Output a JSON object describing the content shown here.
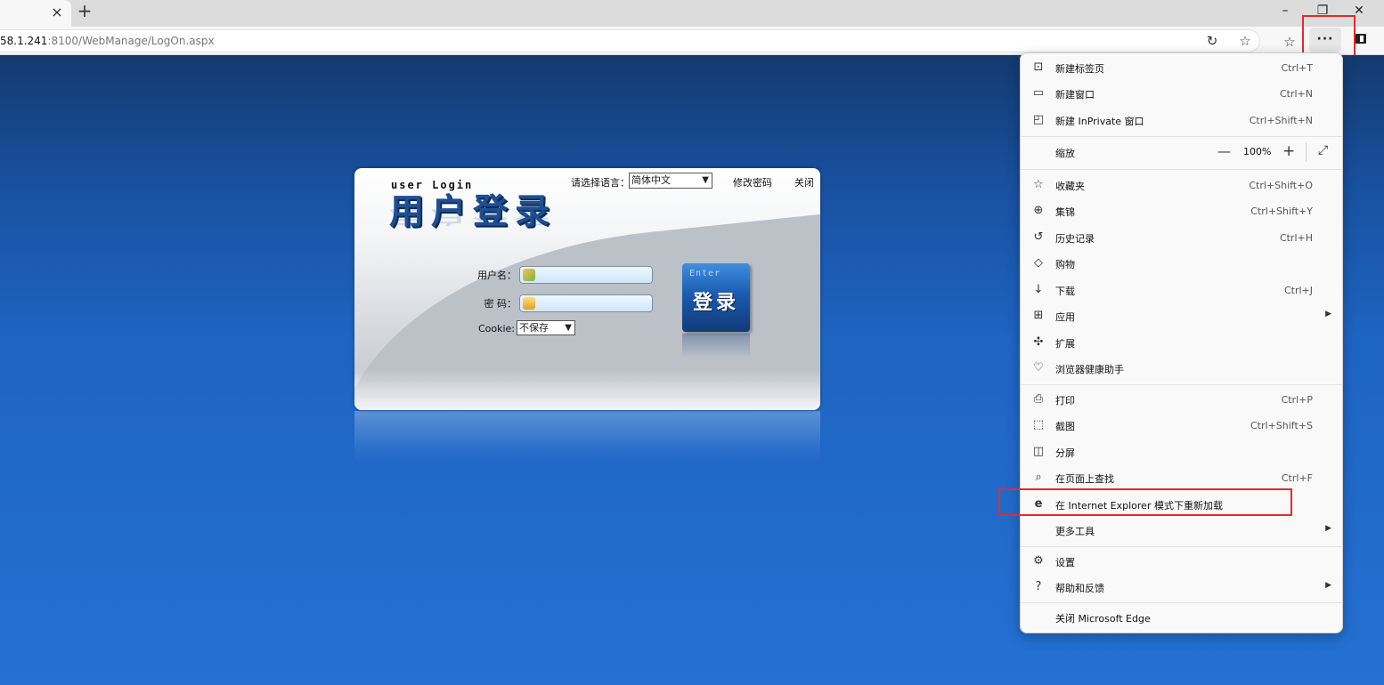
{
  "browser": {
    "tab_close": "×",
    "new_tab": "+",
    "window_controls": {
      "minimize": "–",
      "restore": "❐",
      "close": "✕"
    },
    "url_host": "58.1.241",
    "url_rest": ":8100/WebManage/LogOn.aspx",
    "more_button": "···",
    "toolbar_icons": [
      "refresh-icon",
      "favorite-star-icon",
      "favorites-icon",
      "sidebar-icon"
    ]
  },
  "login": {
    "title_en": "user Login",
    "title_cn": "用户登录",
    "language_label": "请选择语言：",
    "language_value": "简体中文",
    "change_password": "修改密码",
    "close": "关闭",
    "username_label": "用户名：",
    "password_label": "密 码：",
    "cookie_label": "Cookie:",
    "cookie_value": "不保存",
    "enter_en": "Enter",
    "enter_cn": "登录"
  },
  "menu": {
    "items": [
      {
        "label": "新建标签页",
        "shortcut": "Ctrl+T",
        "icon": "new-tab-icon"
      },
      {
        "label": "新建窗口",
        "shortcut": "Ctrl+N",
        "icon": "new-window-icon"
      },
      {
        "label": "新建 InPrivate 窗口",
        "shortcut": "Ctrl+Shift+N",
        "icon": "inprivate-icon"
      },
      {
        "label": "缩放",
        "zoom_value": "100%"
      },
      {
        "label": "收藏夹",
        "shortcut": "Ctrl+Shift+O",
        "icon": "favorites-icon"
      },
      {
        "label": "集锦",
        "shortcut": "Ctrl+Shift+Y",
        "icon": "collections-icon"
      },
      {
        "label": "历史记录",
        "shortcut": "Ctrl+H",
        "icon": "history-icon"
      },
      {
        "label": "购物",
        "shortcut": "",
        "icon": "shopping-tag-icon"
      },
      {
        "label": "下载",
        "shortcut": "Ctrl+J",
        "icon": "download-icon"
      },
      {
        "label": "应用",
        "shortcut": "",
        "icon": "apps-icon"
      },
      {
        "label": "扩展",
        "shortcut": "",
        "icon": "extensions-icon"
      },
      {
        "label": "浏览器健康助手",
        "shortcut": "",
        "icon": "browser-health-icon"
      },
      {
        "label": "打印",
        "shortcut": "Ctrl+P",
        "icon": "print-icon"
      },
      {
        "label": "截图",
        "shortcut": "Ctrl+Shift+S",
        "icon": "screenshot-icon"
      },
      {
        "label": "分屏",
        "shortcut": "",
        "icon": "split-screen-icon"
      },
      {
        "label": "在页面上查找",
        "shortcut": "Ctrl+F",
        "icon": "find-on-page-icon"
      },
      {
        "label": "在 Internet Explorer 模式下重新加载",
        "shortcut": "",
        "icon": "ie-mode-icon"
      },
      {
        "label": "更多工具",
        "shortcut": ""
      },
      {
        "label": "设置",
        "shortcut": "",
        "icon": "settings-gear-icon"
      },
      {
        "label": "帮助和反馈",
        "shortcut": "",
        "icon": "help-icon"
      },
      {
        "label": "关闭 Microsoft Edge",
        "shortcut": ""
      }
    ]
  },
  "colors": {
    "highlight_red": "#e52a2a",
    "page_blue": "#1e64c2"
  }
}
